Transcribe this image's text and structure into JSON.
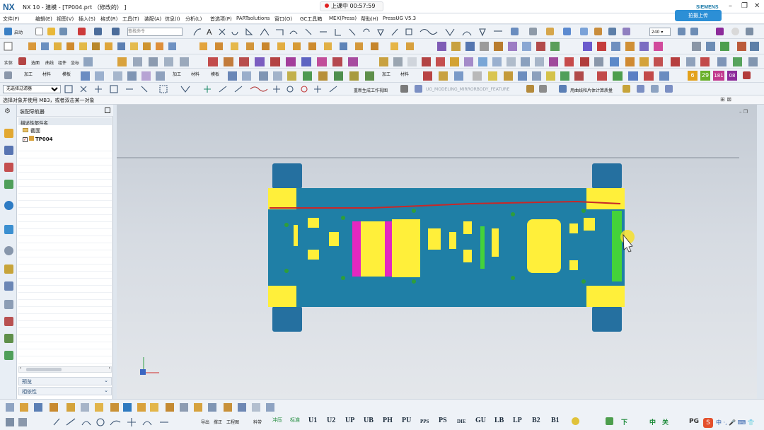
{
  "window": {
    "logo": "NX",
    "title": "NX 10 - 建模 - [TP004.prt （修改的） ]",
    "recording_label": "上课中 00:57:59",
    "brand": "SIEMENS",
    "upload_label": "拍摄上传"
  },
  "menu": [
    "文件(F)",
    "编辑(E)",
    "视图(V)",
    "插入(S)",
    "格式(R)",
    "工具(T)",
    "装配(A)",
    "信息(I)",
    "分析(L)",
    "首选项(P)",
    "PARTsolutions",
    "窗口(O)",
    "GC工具箱",
    "MEX(Press)",
    "帮助(H)",
    "PressUG V5.3"
  ],
  "toolbar": {
    "start_label": "启动",
    "command_search_placeholder": "查找命令",
    "zoom_value": "240",
    "row3_labels": [
      "实体",
      "选面",
      "曲线",
      "组件",
      "坐标"
    ],
    "row4_labels": [
      "加工",
      "材料",
      "模板",
      "加工",
      "材料",
      "模板",
      "加工",
      "材料"
    ],
    "filter_placeholder": "无选择过滤器",
    "regen_label": "重新生成工作视图",
    "feature_label": "UG_MODELING_MIRRORBODY_FEATURE",
    "solid_surface_label": "用曲线和片体计算质量",
    "number_badges": [
      "6",
      "29",
      "181",
      "08"
    ]
  },
  "cue": "选择对象并使用 MB3，或者双击某一对象",
  "navigator": {
    "title": "装配导航器",
    "column_header": "描述性部件名",
    "nodes": [
      "截面",
      "TP004"
    ],
    "panels": [
      "预览",
      "相依性"
    ]
  },
  "bottom_toolbar": {
    "buttons": [
      "U1",
      "U2",
      "UP",
      "UB",
      "PH",
      "PU",
      "PPS",
      "PS",
      "DIE",
      "GU",
      "LB",
      "LP",
      "B2",
      "B1"
    ],
    "labels": [
      "导出",
      "撑正",
      "工程图",
      "料带",
      "冲压",
      "标准",
      "下",
      "中",
      "关",
      "PG"
    ]
  },
  "colors": {
    "die_blue": "#1f7fa6",
    "plate_yellow": "#ffef3a",
    "insert_magenta": "#e328c0",
    "strip_red": "#c82828",
    "guide_green": "#44d23a"
  }
}
